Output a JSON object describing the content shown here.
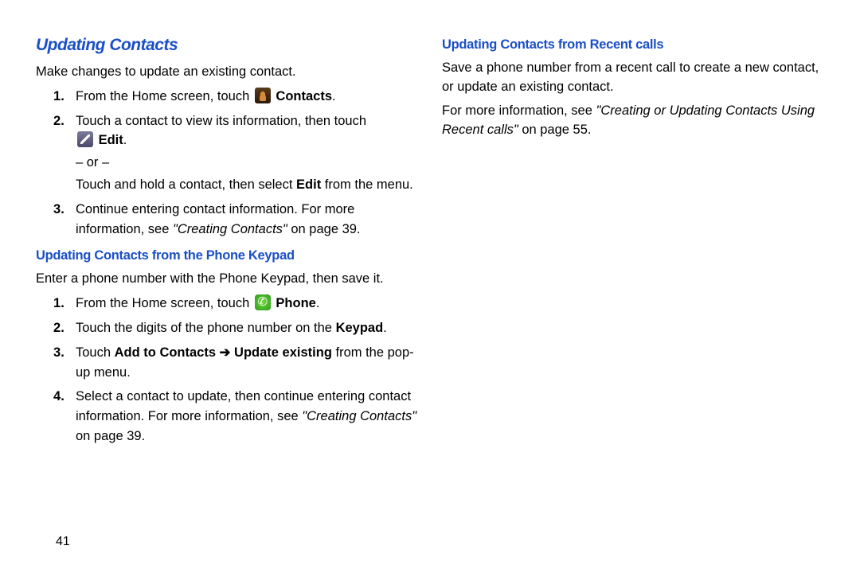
{
  "left": {
    "section1_title": "Updating Contacts",
    "section1_intro": "Make changes to update an existing contact.",
    "section1_step1_a": "From the Home screen, touch ",
    "section1_step1_b": " Contacts",
    "section1_step1_c": ".",
    "section1_step2_a": "Touch a contact to view its information, then touch ",
    "section1_step2_b": " Edit",
    "section1_step2_c": ".",
    "section1_or": "– or –",
    "section1_alt_a": "Touch and hold a contact, then select ",
    "section1_alt_b": "Edit",
    "section1_alt_c": " from the menu.",
    "section1_step3_a": "Continue entering contact information. For more information, see ",
    "section1_step3_b": "\"Creating Contacts\"",
    "section1_step3_c": " on page 39.",
    "section2_title": "Updating Contacts from the Phone Keypad",
    "section2_intro": "Enter a phone number with the Phone Keypad, then save it.",
    "section2_step1_a": "From the Home screen, touch ",
    "section2_step1_b": " Phone",
    "section2_step1_c": ".",
    "section2_step2_a": "Touch the digits of the phone number on the ",
    "section2_step2_b": "Keypad",
    "section2_step2_c": ".",
    "section2_step3_a": "Touch ",
    "section2_step3_b": "Add to Contacts ",
    "section2_step3_arrow": "➔",
    "section2_step3_c": " Update existing",
    "section2_step3_d": " from the pop-up menu.",
    "section2_step4_a": "Select a contact to update, then continue entering contact information. For more information, see ",
    "section2_step4_b": "\"Creating Contacts\"",
    "section2_step4_c": " on page 39."
  },
  "right": {
    "section1_title": "Updating Contacts from Recent calls",
    "section1_intro": "Save a phone number from a recent call to create a new contact, or update an existing contact.",
    "section1_more_a": "For more information, see ",
    "section1_more_b": "\"Creating or Updating Contacts Using Recent calls\"",
    "section1_more_c": " on page 55."
  },
  "page_number": "41"
}
